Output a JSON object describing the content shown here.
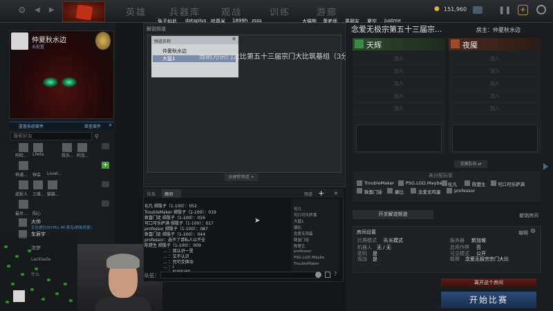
{
  "topbar": {
    "tabs": [
      "英雄",
      "兵器库",
      "观战",
      "训练",
      "游廊"
    ],
    "gold": "151,960"
  },
  "overlay_names": [
    "兔子如此",
    "dotaplus",
    "哈基米",
    "1899h",
    "zsss",
    "大猫熊",
    "萧老师",
    "男朋友",
    "夏空",
    "justme"
  ],
  "profile": {
    "name": "仲夏秋水边",
    "subtitle": "未配置"
  },
  "friends": {
    "header_left": "蓝普系统案件",
    "header_right": "审查案件",
    "search_placeholder": "搜索好友",
    "items": [
      {
        "name": "阿哈..."
      },
      {
        "name": "Lileta"
      },
      {
        "name": "我乐..."
      },
      {
        "name": "阿念..."
      },
      {
        "name": "神通..."
      },
      {
        "name": "钟会"
      },
      {
        "name": "Lovel..."
      },
      {
        "name": "皮影人"
      },
      {
        "name": "三维..."
      },
      {
        "name": "猫猫..."
      },
      {
        "name": "最杀..."
      },
      {
        "name": "阳心"
      },
      {
        "name": "大帅"
      },
      {
        "name": "正在进行DOTA1 IM 菜鸟(刷新修复)"
      },
      {
        "name": "车辰宇"
      },
      {
        "name": "浓梦"
      },
      {
        "name": "Lacklaste"
      },
      {
        "name": "什么"
      }
    ]
  },
  "lobby": {
    "title": "解说频道",
    "channel_header": "频道名称",
    "channels": [
      "仲夏秋水边",
      "大猛1"
    ],
    "create_channel": "创建新频道",
    "overlay_text": "当前为宗门大比第五十三届宗门大比筑基组（3分4分5分）"
  },
  "chat": {
    "tabs": [
      "队伍",
      "房间",
      "频道"
    ],
    "lines": [
      "化凡 掷骰子（1-100）：052",
      "TroubleMaker 掷骰子（1-100）：019",
      "致富门徒 掷骰子（1-100）：016",
      "可口可乐萨满 掷骰子（1-100）：017",
      "professor 掷骰子（1-100）：087",
      "致富门徒 掷骰子（1-100）：044",
      "professor：选不了请私人以不全",
      "陈楚生 掷骰子（1-100）：009",
      "... ：我认识一里",
      "... ：又不认识",
      "... ：完可交换动",
      "... ：i",
      "... ：xuexuan"
    ],
    "members": [
      "化凡",
      "可口可乐萨满",
      "大猛1",
      "康比",
      "念爱无鸡蛋",
      "致富门徒",
      "陈楚生",
      "professor",
      "PSG.LGD.Maybe",
      "TroubleMaker"
    ],
    "input_label": "队伍："
  },
  "room": {
    "name": "念爱无极宗第五十三届宗...",
    "host": "房主：仲夏秋水边",
    "radiant": "天辉",
    "dire": "夜魇",
    "join_label": "加入",
    "swap": "交换队伍",
    "unassigned_title": "未分配玩家",
    "unassigned": [
      "TroubleMaker",
      "PSG.LGD.Maybe",
      "化凡",
      "陈楚生",
      "可口可乐萨满",
      "致富门徒",
      "康比",
      "念爱无鸡蛋",
      "professor"
    ],
    "open_solution": "开关解说频道",
    "leave_link": "撤销房间",
    "settings_title": "房间设置",
    "edit": "编辑",
    "settings": [
      {
        "label": "比赛模式",
        "value": "队长模式"
      },
      {
        "label": "服务器",
        "value": "新加坡"
      },
      {
        "label": "机器人",
        "value": "无 / 无"
      },
      {
        "label": "启用作弊",
        "value": "否"
      },
      {
        "label": "密码",
        "value": "是"
      },
      {
        "label": "可见模式",
        "value": "公开"
      },
      {
        "label": "观战",
        "value": "是"
      },
      {
        "label": "联赛",
        "value": "念爱无极宗宗门大比"
      }
    ],
    "leave_room": "离开这个房间",
    "start": "开始比赛"
  }
}
